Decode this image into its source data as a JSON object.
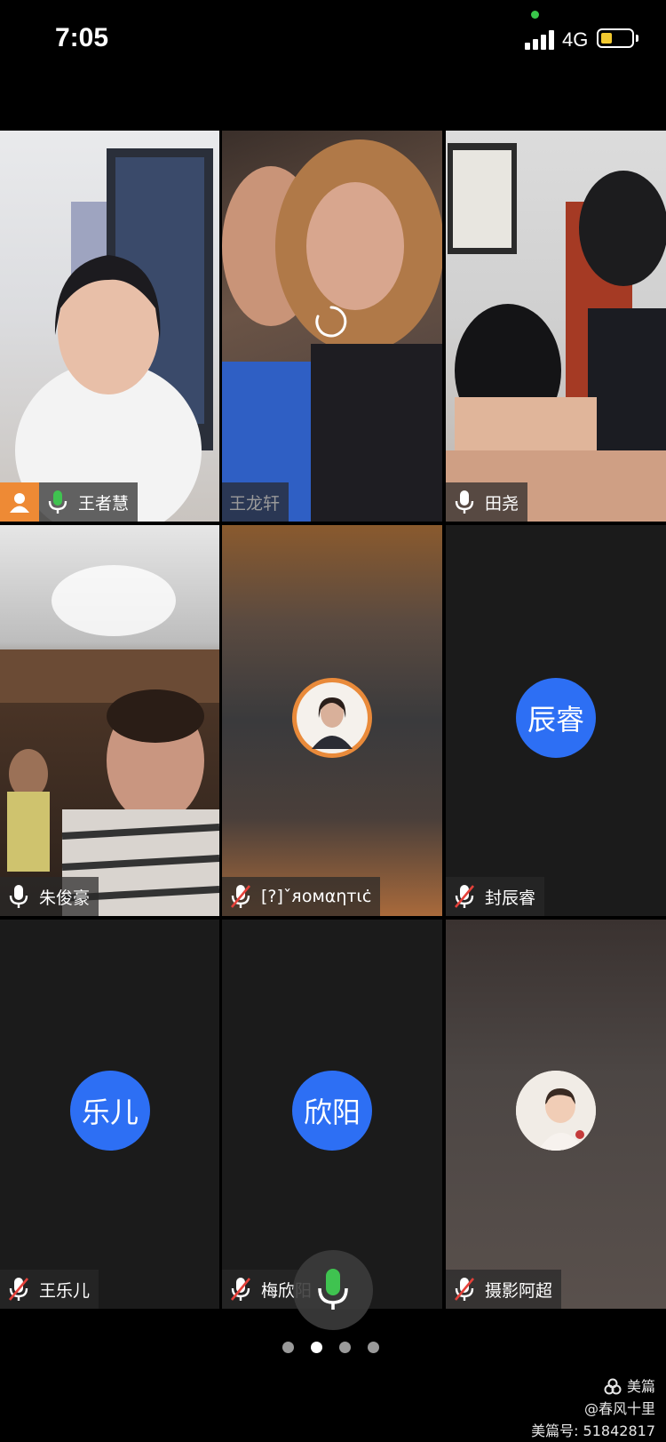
{
  "status": {
    "time": "7:05",
    "network": "4G"
  },
  "participants": [
    {
      "name": "王者慧",
      "mic": "on-green",
      "active": true
    },
    {
      "name": "王龙轩",
      "mic": "none",
      "loading": true
    },
    {
      "name": "田尧",
      "mic": "on"
    },
    {
      "name": "朱俊豪",
      "mic": "on"
    },
    {
      "name": "[?]ˇᴙᴏмαηтιċ",
      "mic": "muted"
    },
    {
      "name": "封辰睿",
      "mic": "muted",
      "avatar_text": "辰睿"
    },
    {
      "name": "王乐儿",
      "mic": "muted",
      "avatar_text": "乐儿"
    },
    {
      "name": "梅欣阳",
      "mic": "muted",
      "avatar_text": "欣阳"
    },
    {
      "name": "摄影阿超",
      "mic": "muted"
    }
  ],
  "icons": {
    "self_mic": "microphone-icon-green",
    "loading": "spinner-icon",
    "host_badge": "person-icon"
  },
  "pagination": {
    "pages": 4,
    "current": 2
  },
  "watermark": {
    "brand": "美篇",
    "author": "@春风十里",
    "id_label": "美篇号: 51842817"
  },
  "colors": {
    "accent_green": "#3fc350",
    "avatar_blue": "#2d6ff4",
    "badge_orange": "#ee8a35"
  }
}
